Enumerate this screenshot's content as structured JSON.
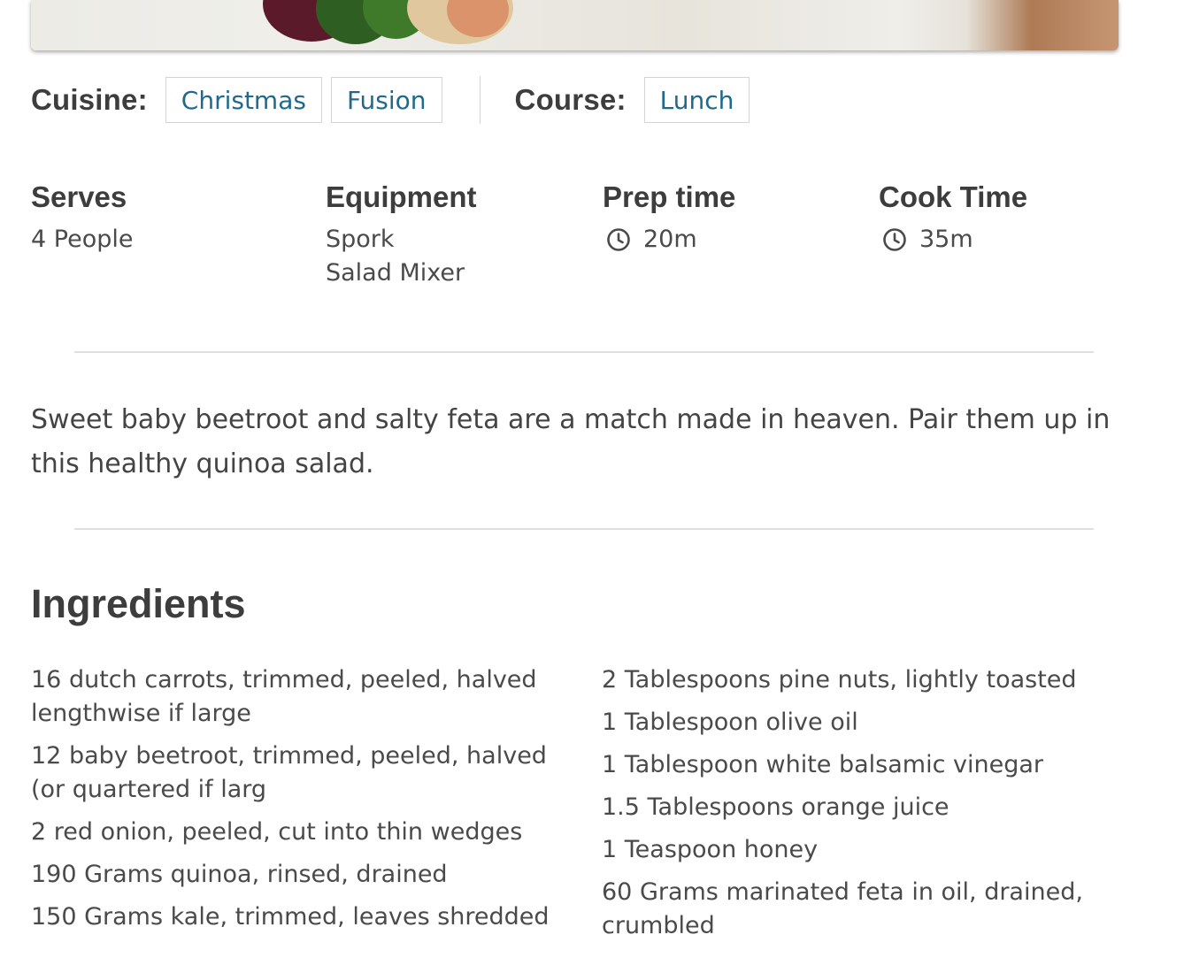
{
  "cuisine": {
    "label": "Cuisine:",
    "tags": [
      "Christmas",
      "Fusion"
    ]
  },
  "course": {
    "label": "Course:",
    "tags": [
      "Lunch"
    ]
  },
  "meta": {
    "serves": {
      "title": "Serves",
      "value": "4 People"
    },
    "equipment": {
      "title": "Equipment",
      "items": [
        "Spork",
        "Salad Mixer"
      ]
    },
    "prep_time": {
      "title": "Prep time",
      "value": "20m",
      "icon": "clock-icon"
    },
    "cook_time": {
      "title": "Cook Time",
      "value": "35m",
      "icon": "clock-icon"
    }
  },
  "description": "Sweet baby beetroot and salty feta are a match made in heaven. Pair them up in this healthy quinoa salad.",
  "ingredients": {
    "title": "Ingredients",
    "left": [
      "16 dutch carrots, trimmed, peeled, halved lengthwise if large",
      "12 baby beetroot, trimmed, peeled, halved (or quartered if larg",
      "2 red onion, peeled, cut into thin wedges",
      "190 Grams quinoa, rinsed, drained",
      "150 Grams kale, trimmed, leaves shredded"
    ],
    "right": [
      "2 Tablespoons pine nuts, lightly toasted",
      "1 Tablespoon olive oil",
      "1 Tablespoon white balsamic vinegar",
      "1.5 Tablespoons orange juice",
      "1 Teaspoon honey",
      "60 Grams marinated feta in oil, drained, crumbled"
    ]
  },
  "colors": {
    "tag_text": "#1f6a8c",
    "tag_border": "#d4d4d4",
    "heading": "#3d3d3d",
    "body_text": "#4a4a4a",
    "divider": "#dedede"
  }
}
